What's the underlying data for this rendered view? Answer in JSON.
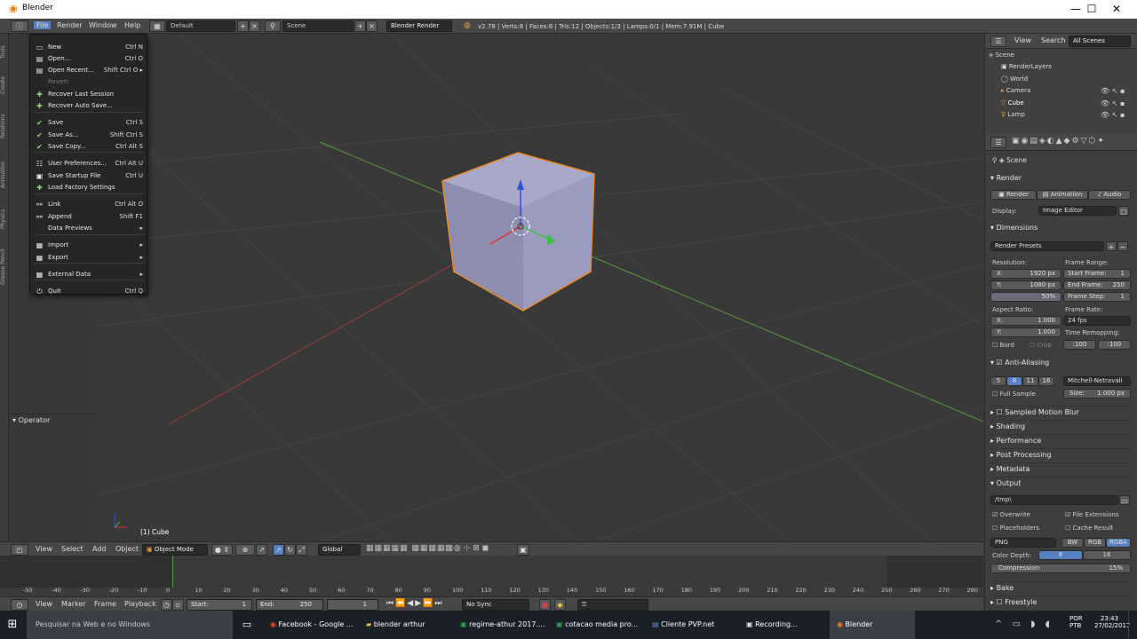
{
  "window": {
    "title": "Blender",
    "min": "—",
    "max": "☐",
    "close": "✕"
  },
  "infobar": {
    "menus": [
      "File",
      "Render",
      "Window",
      "Help"
    ],
    "layout": "Default",
    "scene": "Scene",
    "engine": "Blender Render",
    "stats": "v2.78 | Verts:8 | Faces:6 | Tris:12 | Objects:1/3 | Lamps:0/1 | Mem:7.91M | Cube"
  },
  "file_menu": {
    "items": [
      {
        "label": "New",
        "shortcut": "Ctrl N",
        "icon": "new-file-icon"
      },
      {
        "label": "Open...",
        "shortcut": "Ctrl O",
        "icon": "folder-icon"
      },
      {
        "label": "Open Recent...",
        "shortcut": "Shift Ctrl O  ▸",
        "icon": "recent-icon"
      },
      {
        "label": "Revert",
        "shortcut": "",
        "icon": ""
      },
      {
        "label": "Recover Last Session",
        "shortcut": "",
        "icon": "recover-icon"
      },
      {
        "label": "Recover Auto Save...",
        "shortcut": "",
        "icon": "recover-icon"
      },
      {
        "label": "Save",
        "shortcut": "Ctrl S",
        "icon": "check-icon"
      },
      {
        "label": "Save As...",
        "shortcut": "Shift Ctrl S",
        "icon": "check-icon"
      },
      {
        "label": "Save Copy...",
        "shortcut": "Ctrl Alt S",
        "icon": "check-icon"
      },
      {
        "label": "User Preferences...",
        "shortcut": "Ctrl Alt U",
        "icon": "preferences-icon"
      },
      {
        "label": "Save Startup File",
        "shortcut": "Ctrl U",
        "icon": "save-startup-icon"
      },
      {
        "label": "Load Factory Settings",
        "shortcut": "",
        "icon": "factory-icon"
      },
      {
        "label": "Link",
        "shortcut": "Ctrl Alt O",
        "icon": "link-icon"
      },
      {
        "label": "Append",
        "shortcut": "Shift F1",
        "icon": "append-icon"
      },
      {
        "label": "Data Previews",
        "shortcut": "▸",
        "icon": ""
      },
      {
        "label": "Import",
        "shortcut": "▸",
        "icon": "import-icon"
      },
      {
        "label": "Export",
        "shortcut": "▸",
        "icon": "export-icon"
      },
      {
        "label": "External Data",
        "shortcut": "▸",
        "icon": "external-icon"
      },
      {
        "label": "Quit",
        "shortcut": "Ctrl Q",
        "icon": "power-icon"
      }
    ]
  },
  "toolshelf": {
    "operator": "Operator",
    "tabs": [
      "Tools",
      "Create",
      "Relations",
      "Animation",
      "Physics",
      "Grease Pencil"
    ]
  },
  "viewport": {
    "object_label": "(1) Cube"
  },
  "outliner": {
    "view": "View",
    "search": "Search",
    "filter": "All Scenes",
    "items": [
      "Scene",
      "RenderLayers",
      "World",
      "Camera",
      "Cube",
      "Lamp"
    ]
  },
  "properties": {
    "context": "Scene",
    "render": {
      "title": "Render",
      "render_btn": "Render",
      "animation_btn": "Animation",
      "audio_btn": "Audio",
      "display_label": "Display:",
      "display_value": "Image Editor"
    },
    "dimensions": {
      "title": "Dimensions",
      "presets": "Render Presets",
      "resolution_label": "Resolution:",
      "x": "X:",
      "x_val": "1920 px",
      "y": "Y:",
      "y_val": "1080 px",
      "pct": "50%",
      "frame_range_label": "Frame Range:",
      "start": "Start Frame:",
      "start_val": "1",
      "end": "End Frame:",
      "end_val": "250",
      "step": "Frame Step:",
      "step_val": "1",
      "aspect_label": "Aspect Ratio:",
      "ax_val": "1.000",
      "ay_val": "1.000",
      "framerate_label": "Frame Rate:",
      "fps": "24 fps",
      "remap_label": "Time Remapping:",
      "remap_old": ":100",
      "remap_new": ":100",
      "bord": "Bord",
      "crop": "Crop"
    },
    "aa": {
      "title": "Anti-Aliasing",
      "samples": [
        "5",
        "8",
        "11",
        "16"
      ],
      "filter": "Mitchell-Netravali",
      "full_sample": "Full Sample",
      "size_label": "Size:",
      "size": "1.000 px"
    },
    "collapsed": [
      "Sampled Motion Blur",
      "Shading",
      "Performance",
      "Post Processing",
      "Metadata"
    ],
    "output": {
      "title": "Output",
      "path": "/tmp\\",
      "overwrite": "Overwrite",
      "file_ext": "File Extensions",
      "placeholders": "Placeholders",
      "cache": "Cache Result",
      "format": "PNG",
      "bw": "BW",
      "rgb": "RGB",
      "rgba": "RGBA",
      "depth_label": "Color Depth:",
      "depth8": "8",
      "depth16": "16",
      "compression": "Compression:",
      "compression_val": "15%"
    },
    "bake": "Bake",
    "freestyle": "Freestyle"
  },
  "view3d_header": {
    "view": "View",
    "select": "Select",
    "add": "Add",
    "object": "Object",
    "mode": "Object Mode",
    "orientation": "Global"
  },
  "timeline": {
    "ticks": [
      "-50",
      "-40",
      "-30",
      "-20",
      "-10",
      "0",
      "10",
      "20",
      "30",
      "40",
      "50",
      "60",
      "70",
      "80",
      "90",
      "100",
      "110",
      "120",
      "130",
      "140",
      "150",
      "160",
      "170",
      "180",
      "190",
      "200",
      "210",
      "220",
      "230",
      "240",
      "250",
      "260",
      "270",
      "280"
    ],
    "view": "View",
    "marker": "Marker",
    "frame": "Frame",
    "playback": "Playback",
    "start_label": "Start:",
    "start_val": "1",
    "end_label": "End:",
    "end_val": "250",
    "current": "1",
    "sync": "No Sync"
  },
  "taskbar": {
    "search": "Pesquisar na Web e no Windows",
    "apps": [
      "Facebook - Google ...",
      "blender arthur",
      "regime-athur 2017....",
      "cotacao media pro...",
      "Cliente PVP.net",
      "Recording...",
      "Blender"
    ],
    "lang1": "POR",
    "lang2": "PTB",
    "time": "23:43",
    "date": "27/02/2017"
  },
  "colors": {
    "accent": "#5680c2",
    "selection": "#e88a2b"
  }
}
